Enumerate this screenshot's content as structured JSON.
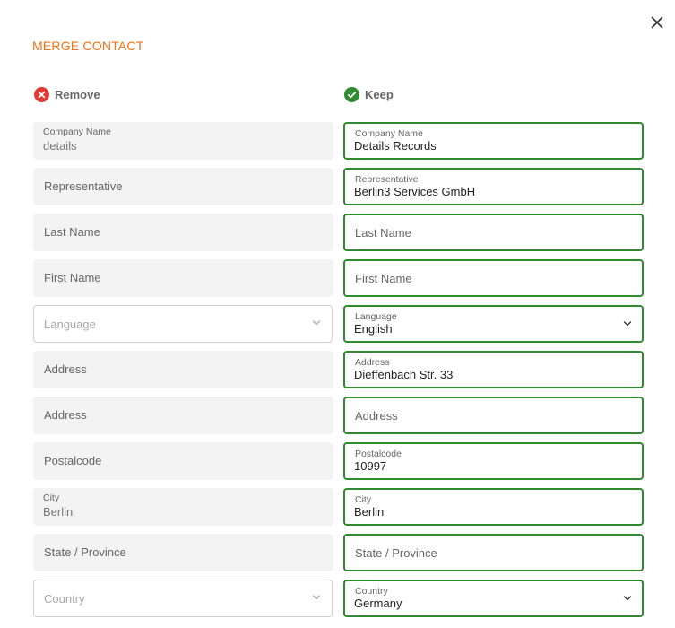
{
  "dialog": {
    "title": "MERGE CONTACT",
    "close_icon": "close-icon",
    "accent_color": "#f07315",
    "keep_color": "#2e8b2e",
    "remove_color": "#e53935"
  },
  "columns": {
    "remove_label": "Remove",
    "keep_label": "Keep"
  },
  "rows": [
    {
      "key": "company_name",
      "remove": {
        "label": "Company Name",
        "value": "details"
      },
      "keep": {
        "label": "Company Name",
        "value": "Details Records"
      }
    },
    {
      "key": "representative",
      "remove": {
        "label": "Representative",
        "value": ""
      },
      "keep": {
        "label": "Representative",
        "value": "Berlin3 Services GmbH"
      }
    },
    {
      "key": "last_name",
      "remove": {
        "label": "Last Name",
        "value": ""
      },
      "keep": {
        "label": "Last Name",
        "value": ""
      }
    },
    {
      "key": "first_name",
      "remove": {
        "label": "First Name",
        "value": ""
      },
      "keep": {
        "label": "First Name",
        "value": ""
      }
    },
    {
      "key": "language",
      "select": true,
      "remove": {
        "label": "Language",
        "value": ""
      },
      "keep": {
        "label": "Language",
        "value": "English"
      }
    },
    {
      "key": "address_1",
      "remove": {
        "label": "Address",
        "value": ""
      },
      "keep": {
        "label": "Address",
        "value": "Dieffenbach Str. 33"
      }
    },
    {
      "key": "address_2",
      "remove": {
        "label": "Address",
        "value": ""
      },
      "keep": {
        "label": "Address",
        "value": ""
      }
    },
    {
      "key": "postalcode",
      "remove": {
        "label": "Postalcode",
        "value": ""
      },
      "keep": {
        "label": "Postalcode",
        "value": "10997"
      }
    },
    {
      "key": "city",
      "remove": {
        "label": "City",
        "value": "Berlin"
      },
      "keep": {
        "label": "City",
        "value": "Berlin"
      }
    },
    {
      "key": "state",
      "remove": {
        "label": "State / Province",
        "value": ""
      },
      "keep": {
        "label": "State / Province",
        "value": ""
      }
    },
    {
      "key": "country",
      "select": true,
      "remove": {
        "label": "Country",
        "value": ""
      },
      "keep": {
        "label": "Country",
        "value": "Germany"
      }
    }
  ]
}
